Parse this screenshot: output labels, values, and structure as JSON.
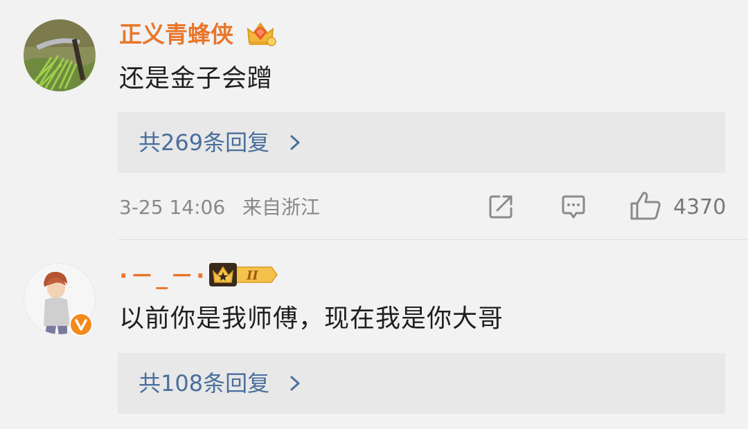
{
  "comments": [
    {
      "username": "正义青蜂侠",
      "text": "还是金子会蹭",
      "replies": "共269条回复",
      "date": "3-25 14:06",
      "location": "来自浙江",
      "likes": "4370",
      "badge_icon": "diamond-crown-icon",
      "avatar_icon": "sickle-grass-avatar"
    },
    {
      "username": "·－_－·",
      "text": "以前你是我师傅，现在我是你大哥",
      "replies": "共108条回复",
      "badge_icon": "crown-level-II-icon",
      "badge_text": "II",
      "avatar_icon": "cartoon-boy-avatar",
      "verified_icon": "verified-v-icon"
    }
  ],
  "colors": {
    "username": "#e8762c",
    "reply_link": "#4a6e9c",
    "background": "#f2f2f2",
    "reply_box": "#e8e8e8"
  }
}
